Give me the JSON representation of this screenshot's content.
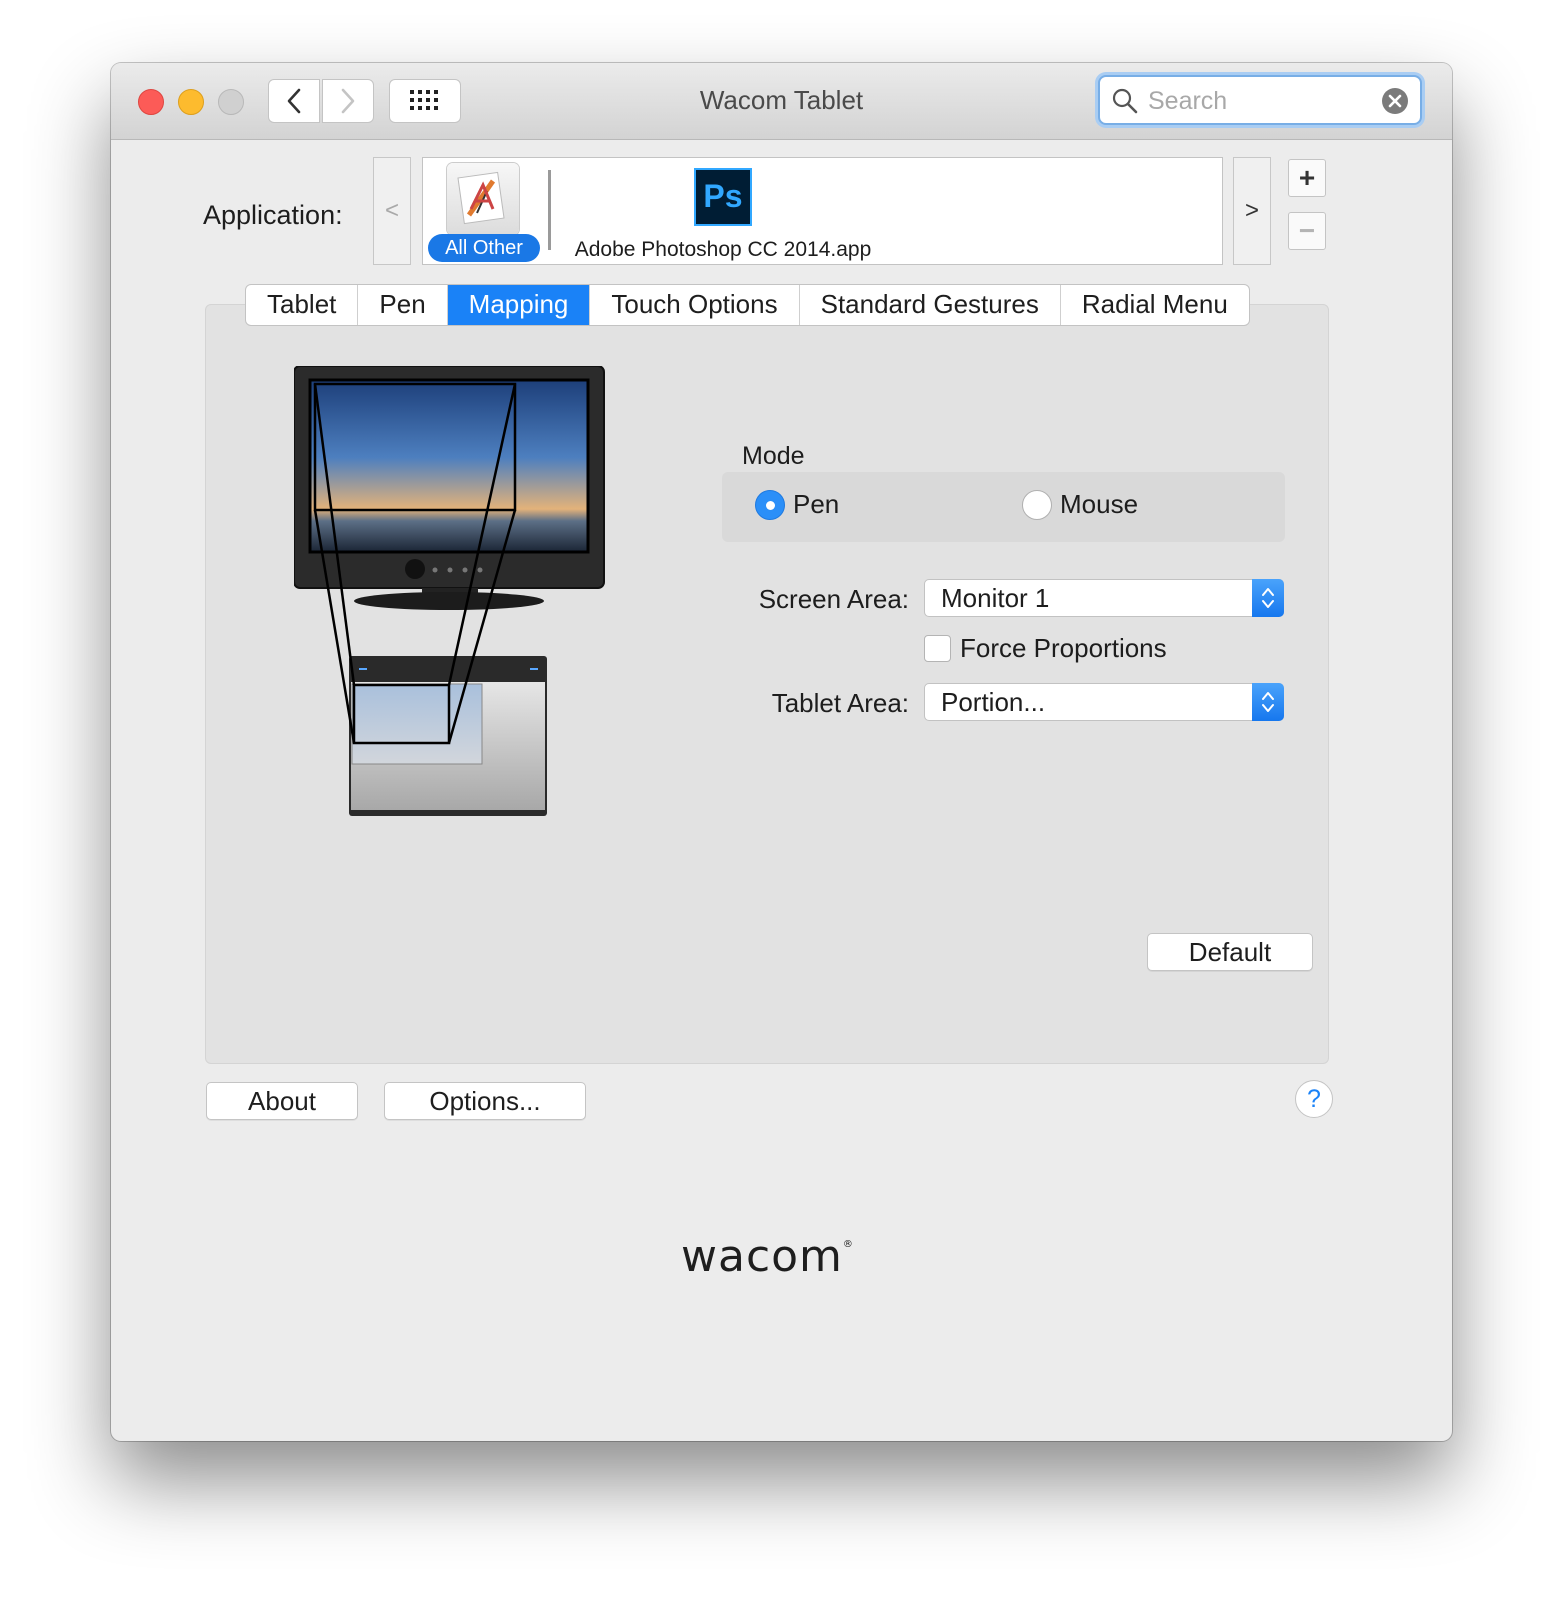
{
  "window": {
    "title": "Wacom Tablet"
  },
  "toolbar": {
    "back_icon": "chevron-left-icon",
    "forward_icon": "chevron-right-icon",
    "grid_icon": "show-all-grid-icon"
  },
  "search": {
    "placeholder": "Search",
    "value": ""
  },
  "application": {
    "label": "Application:",
    "scroll_left": "<",
    "scroll_right": ">",
    "items": [
      {
        "label": "All Other",
        "icon": "all-other-apps-icon",
        "selected": true
      },
      {
        "label": "Adobe Photoshop CC 2014.app",
        "icon": "photoshop-icon",
        "icon_text": "Ps",
        "selected": false
      }
    ],
    "add": "+",
    "remove": "−"
  },
  "tabs": [
    {
      "label": "Tablet",
      "active": false
    },
    {
      "label": "Pen",
      "active": false
    },
    {
      "label": "Mapping",
      "active": true
    },
    {
      "label": "Touch Options",
      "active": false
    },
    {
      "label": "Standard Gestures",
      "active": false
    },
    {
      "label": "Radial Menu",
      "active": false
    }
  ],
  "mapping": {
    "mode_label": "Mode",
    "mode_options": [
      {
        "label": "Pen",
        "selected": true
      },
      {
        "label": "Mouse",
        "selected": false
      }
    ],
    "screen_area_label": "Screen Area:",
    "screen_area_value": "Monitor 1",
    "force_proportions_label": "Force Proportions",
    "force_proportions_checked": false,
    "tablet_area_label": "Tablet Area:",
    "tablet_area_value": "Portion...",
    "default_button": "Default"
  },
  "footer": {
    "about_button": "About",
    "options_button": "Options...",
    "help_button": "?",
    "logo": "wacom"
  },
  "colors": {
    "accent": "#1a82f7",
    "close": "#fc5b57",
    "minimize": "#fdbb2e",
    "zoom": "#d0d0d0"
  }
}
